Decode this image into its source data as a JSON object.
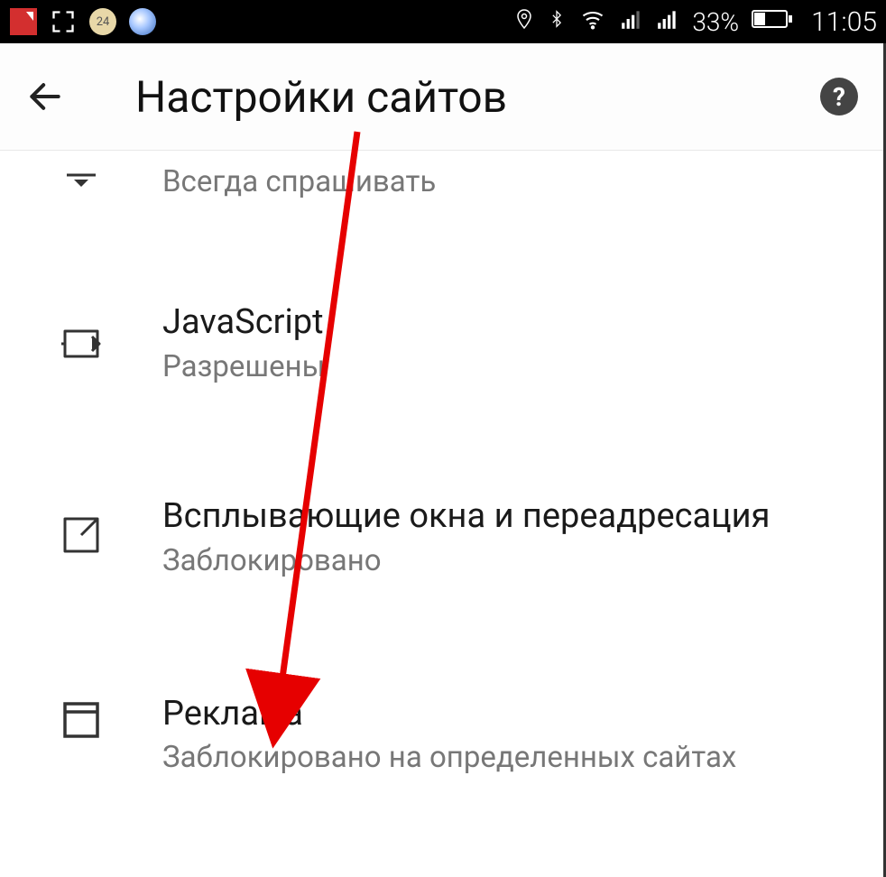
{
  "status_bar": {
    "battery_percent": "33%",
    "clock": "11:05",
    "round_badge_text": "24"
  },
  "header": {
    "title": "Настройки сайтов"
  },
  "settings": {
    "prev_subtitle": "Всегда спрашивать",
    "javascript": {
      "title": "JavaScript",
      "subtitle": "Разрешены"
    },
    "popups": {
      "title": "Всплывающие окна и переадресация",
      "subtitle": "Заблокировано"
    },
    "ads": {
      "title": "Реклама",
      "subtitle": "Заблокировано на определенных сайтах"
    }
  }
}
